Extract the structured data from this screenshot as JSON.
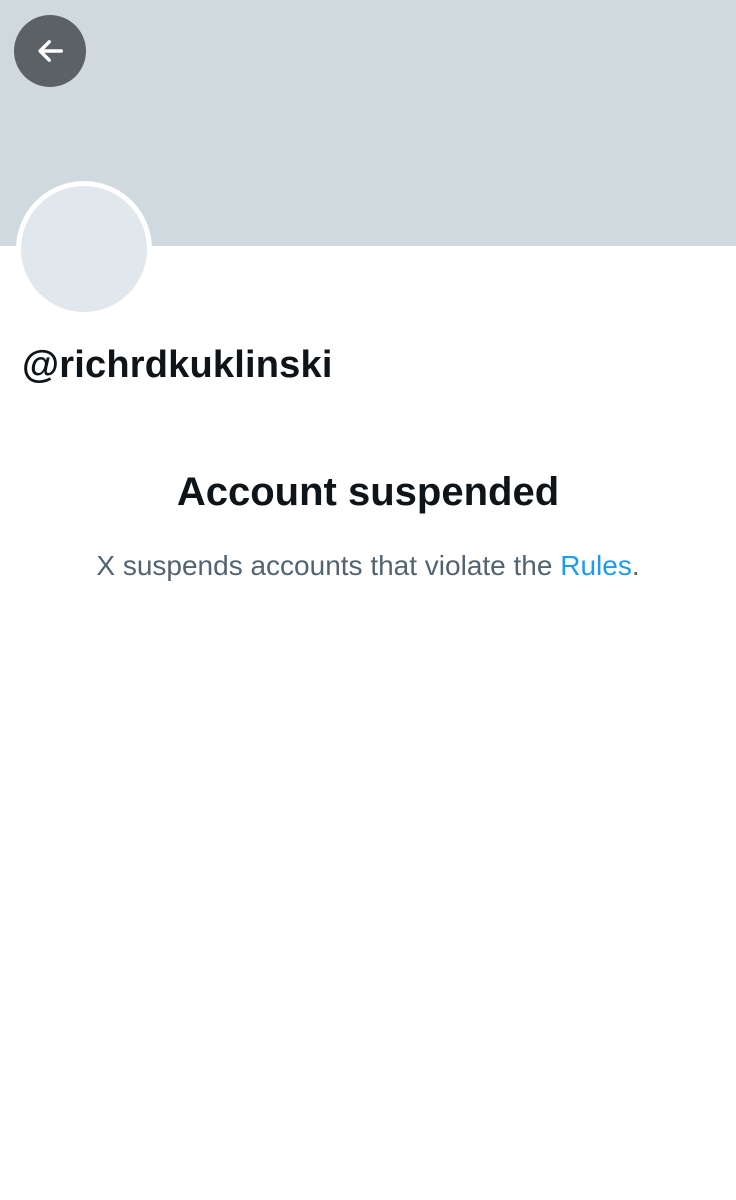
{
  "header": {
    "back_icon": "arrow-left-icon"
  },
  "profile": {
    "handle": "@richrdkuklinski"
  },
  "notice": {
    "title": "Account suspended",
    "description_prefix": "X suspends accounts that violate the ",
    "rules_link_label": "Rules",
    "description_suffix": "."
  },
  "colors": {
    "banner": "#cfd9de",
    "avatar_placeholder": "#e1e8ed",
    "back_button_bg": "#5c6166",
    "primary_text": "#0f1419",
    "secondary_text": "#536471",
    "link": "#1d9bf0"
  }
}
